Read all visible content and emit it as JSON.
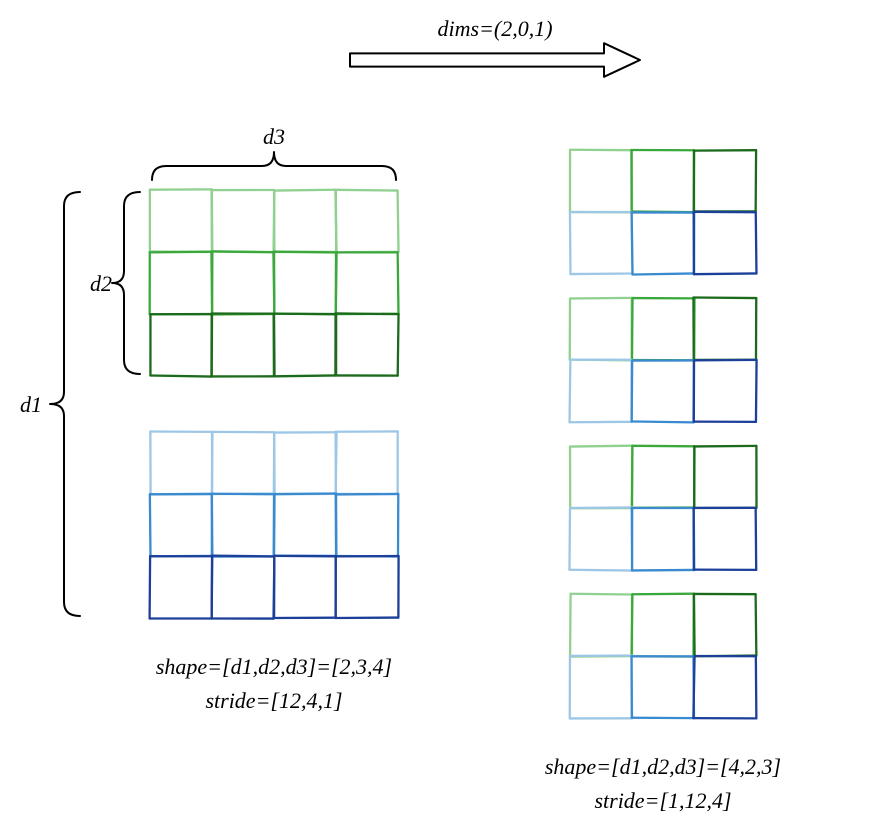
{
  "arrow": {
    "label": "dims=(2,0,1)"
  },
  "left": {
    "dim_outer": "d1",
    "dim_mid": "d2",
    "dim_inner": "d3",
    "shape_line": "shape=[d1,d2,d3]=[2,3,4]",
    "stride_line": "stride=[12,4,1]",
    "grid": {
      "rows": 3,
      "cols": 4,
      "cell": 62
    },
    "blocks": 2,
    "green_rows": [
      "#90d090",
      "#3aa83a",
      "#1c6b1c"
    ],
    "blue_rows": [
      "#9ec7e6",
      "#3a8ad0",
      "#1c3f99"
    ]
  },
  "right": {
    "shape_line": "shape=[d1,d2,d3]=[4,2,3]",
    "stride_line": "stride=[1,12,4]",
    "grid": {
      "rows": 2,
      "cols": 3,
      "cell": 62
    },
    "blocks": 4,
    "green_cols": [
      "#90d090",
      "#3aa83a",
      "#1c6b1c"
    ],
    "blue_cols": [
      "#9ec7e6",
      "#3a8ad0",
      "#1c3f99"
    ]
  }
}
